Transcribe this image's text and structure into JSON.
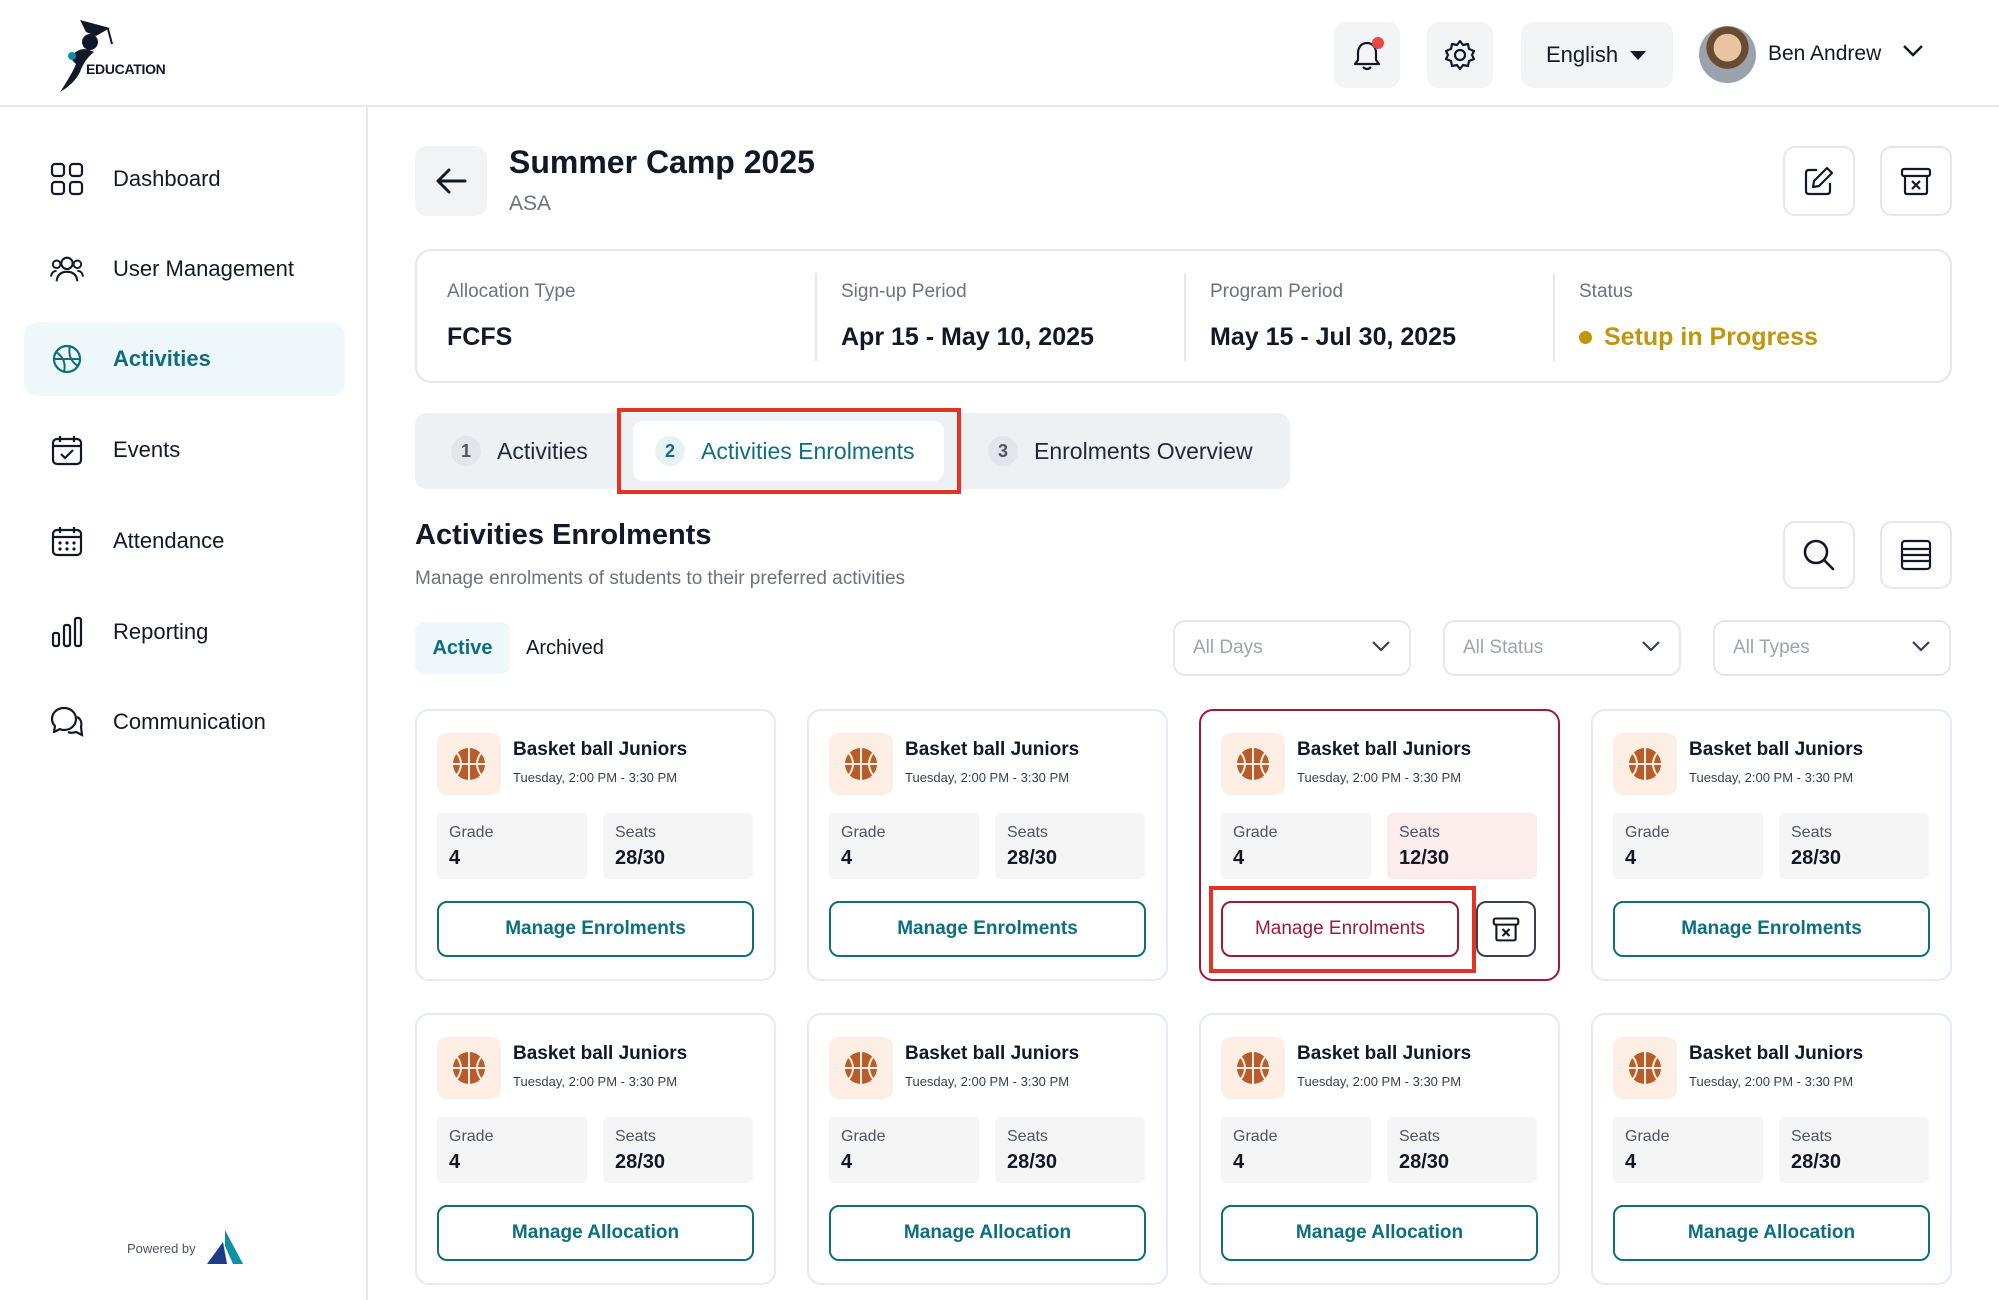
{
  "brand": {
    "logo_text": "EDUCATION"
  },
  "topbar": {
    "language": "English",
    "user_name": "Ben Andrew"
  },
  "sidebar": {
    "items": [
      {
        "label": "Dashboard",
        "icon": "dashboard-icon",
        "active": false
      },
      {
        "label": "User Management",
        "icon": "users-icon",
        "active": false
      },
      {
        "label": "Activities",
        "icon": "activities-icon",
        "active": true
      },
      {
        "label": "Events",
        "icon": "calendar-check-icon",
        "active": false
      },
      {
        "label": "Attendance",
        "icon": "calendar-grid-icon",
        "active": false
      },
      {
        "label": "Reporting",
        "icon": "bar-chart-icon",
        "active": false
      },
      {
        "label": "Communication",
        "icon": "chat-icon",
        "active": false
      }
    ],
    "powered_by": "Powered by"
  },
  "header": {
    "title": "Summer Camp 2025",
    "subtitle": "ASA"
  },
  "info": {
    "allocation_type": {
      "label": "Allocation Type",
      "value": "FCFS"
    },
    "signup_period": {
      "label": "Sign-up Period",
      "value": "Apr 15 - May 10, 2025"
    },
    "program_period": {
      "label": "Program Period",
      "value": "May 15 - Jul 30, 2025"
    },
    "status": {
      "label": "Status",
      "value": "Setup in Progress"
    }
  },
  "steps": [
    {
      "num": "1",
      "label": "Activities"
    },
    {
      "num": "2",
      "label": "Activities Enrolments"
    },
    {
      "num": "3",
      "label": "Enrolments Overview"
    }
  ],
  "section": {
    "title": "Activities Enrolments",
    "subtitle": "Manage enrolments of students to their preferred activities"
  },
  "filters": {
    "tab_active": "Active",
    "tab_archived": "Archived",
    "days": "All Days",
    "status": "All Status",
    "types": "All Types"
  },
  "cards": [
    {
      "title": "Basket ball Juniors",
      "time": "Tuesday, 2:00 PM - 3:30 PM",
      "grade_label": "Grade",
      "grade": "4",
      "seats_label": "Seats",
      "seats": "28/30",
      "action": "Manage Enrolments"
    },
    {
      "title": "Basket ball Juniors",
      "time": "Tuesday, 2:00 PM - 3:30 PM",
      "grade_label": "Grade",
      "grade": "4",
      "seats_label": "Seats",
      "seats": "28/30",
      "action": "Manage Enrolments"
    },
    {
      "title": "Basket ball Juniors",
      "time": "Tuesday, 2:00 PM - 3:30 PM",
      "grade_label": "Grade",
      "grade": "4",
      "seats_label": "Seats",
      "seats": "12/30",
      "action": "Manage Enrolments"
    },
    {
      "title": "Basket ball Juniors",
      "time": "Tuesday, 2:00 PM - 3:30 PM",
      "grade_label": "Grade",
      "grade": "4",
      "seats_label": "Seats",
      "seats": "28/30",
      "action": "Manage Enrolments"
    },
    {
      "title": "Basket ball Juniors",
      "time": "Tuesday, 2:00 PM - 3:30 PM",
      "grade_label": "Grade",
      "grade": "4",
      "seats_label": "Seats",
      "seats": "28/30",
      "action": "Manage Allocation"
    },
    {
      "title": "Basket ball Juniors",
      "time": "Tuesday, 2:00 PM - 3:30 PM",
      "grade_label": "Grade",
      "grade": "4",
      "seats_label": "Seats",
      "seats": "28/30",
      "action": "Manage Allocation"
    },
    {
      "title": "Basket ball Juniors",
      "time": "Tuesday, 2:00 PM - 3:30 PM",
      "grade_label": "Grade",
      "grade": "4",
      "seats_label": "Seats",
      "seats": "28/30",
      "action": "Manage Allocation"
    },
    {
      "title": "Basket ball Juniors",
      "time": "Tuesday, 2:00 PM - 3:30 PM",
      "grade_label": "Grade",
      "grade": "4",
      "seats_label": "Seats",
      "seats": "28/30",
      "action": "Manage Allocation"
    }
  ],
  "colors": {
    "accent": "#0e6e80",
    "status": "#c0960f",
    "danger": "#9c1b3a",
    "highlight": "#e53323"
  }
}
